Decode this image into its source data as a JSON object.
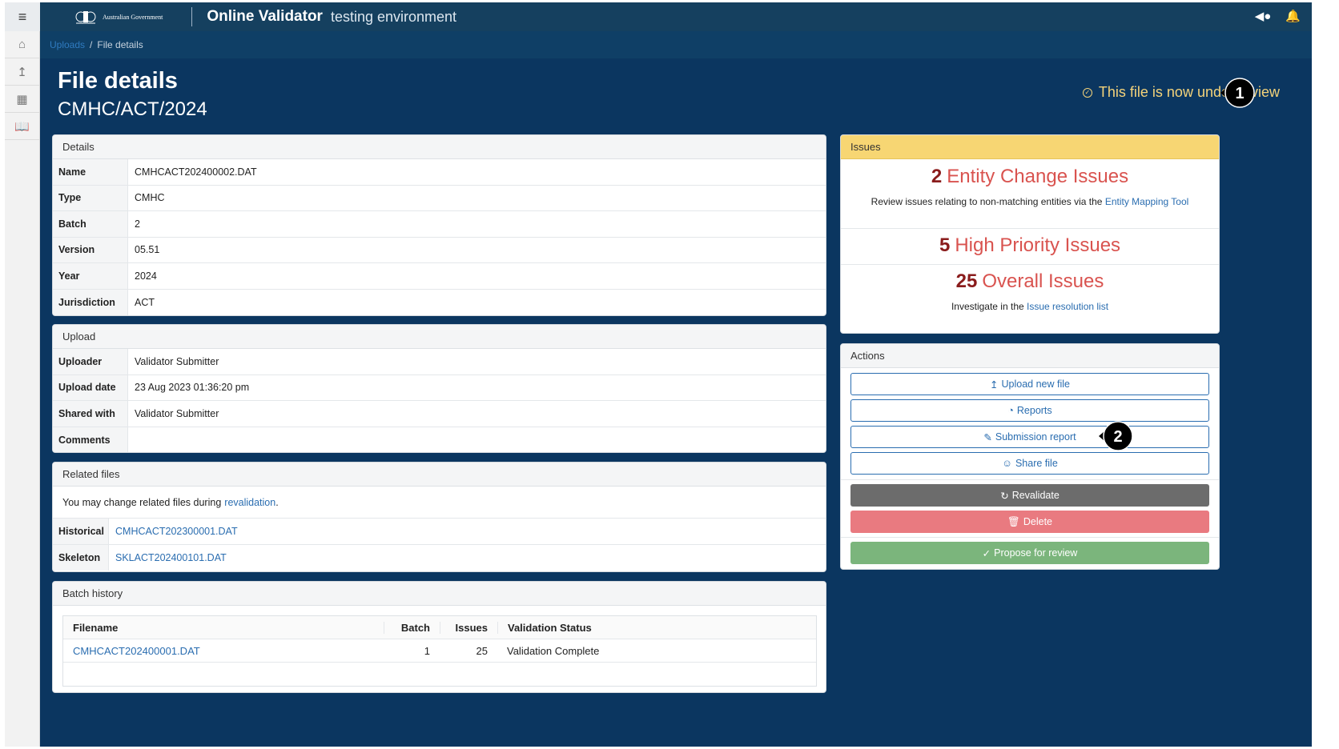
{
  "app": {
    "menu_icon": "hamburger-icon",
    "gov_logo_text": "Australian Government",
    "title": "Online Validator",
    "environment": "testing environment"
  },
  "breadcrumb": {
    "items": [
      "Uploads",
      "File details"
    ],
    "separator": "/"
  },
  "page": {
    "title": "File details",
    "subtitle": "CMHC/ACT/2024",
    "review_status": "This file is now under review"
  },
  "callouts": [
    "1",
    "2"
  ],
  "details": {
    "heading": "Details",
    "rows": [
      {
        "key": "Name",
        "value": "CMHCACT202400002.DAT"
      },
      {
        "key": "Type",
        "value": "CMHC"
      },
      {
        "key": "Batch",
        "value": "2"
      },
      {
        "key": "Version",
        "value": "05.51"
      },
      {
        "key": "Year",
        "value": "2024"
      },
      {
        "key": "Jurisdiction",
        "value": "ACT"
      }
    ]
  },
  "upload": {
    "heading": "Upload",
    "rows": [
      {
        "key": "Uploader",
        "value": "Validator Submitter"
      },
      {
        "key": "Upload date",
        "value": "23 Aug 2023 01:36:20 pm"
      },
      {
        "key": "Shared with",
        "value": "Validator Submitter"
      },
      {
        "key": "Comments",
        "value": ""
      }
    ]
  },
  "related": {
    "heading": "Related files",
    "note_prefix": "You may change related files during ",
    "note_link": "revalidation",
    "note_suffix": ".",
    "rows": [
      {
        "key": "Historical",
        "value": "CMHCACT202300001.DAT"
      },
      {
        "key": "Skeleton",
        "value": "SKLACT202400101.DAT"
      }
    ]
  },
  "batch_history": {
    "heading": "Batch history",
    "columns": [
      "Filename",
      "Batch",
      "Issues",
      "Validation Status"
    ],
    "rows": [
      {
        "filename": "CMHCACT202400001.DAT",
        "batch": "1",
        "issues": "25",
        "status": "Validation Complete"
      }
    ]
  },
  "issues": {
    "heading": "Issues",
    "entity": {
      "count": "2",
      "label": "Entity Change Issues",
      "note_prefix": "Review issues relating to non-matching entities via the ",
      "note_link": "Entity Mapping Tool"
    },
    "high": {
      "count": "5",
      "label": "High Priority Issues"
    },
    "overall": {
      "count": "25",
      "label": "Overall Issues",
      "note_prefix": "Investigate in the ",
      "note_link": "Issue resolution list"
    }
  },
  "actions": {
    "heading": "Actions",
    "upload_new": "Upload new file",
    "reports": "Reports",
    "submission_report": "Submission report",
    "share_file": "Share file",
    "revalidate": "Revalidate",
    "delete": "Delete",
    "propose": "Propose for review"
  },
  "colors": {
    "background": "#0b3660",
    "accent_yellow": "#f4d37a",
    "issues_header": "#f7d673",
    "issue_red": "#d9534f",
    "link_blue": "#2a6db0",
    "delete_red": "#e97a80",
    "propose_green": "#7bb57c"
  }
}
